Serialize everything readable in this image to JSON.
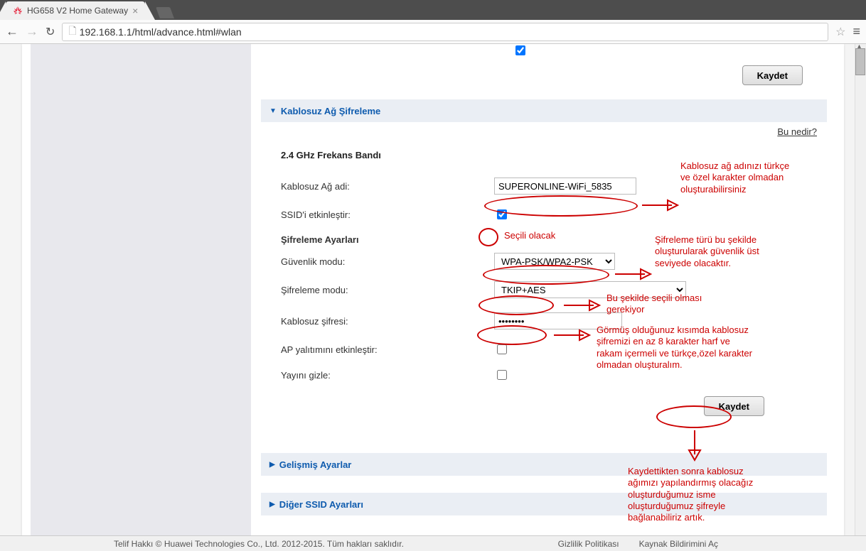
{
  "browser": {
    "tab_title": "HG658 V2 Home Gateway",
    "url": "192.168.1.1/html/advance.html#wlan"
  },
  "page": {
    "top_save_btn": "Kaydet",
    "section_wifi_enc": "Kablosuz Ağ Şifreleme",
    "help_link": "Bu nedir?",
    "band_title": "2.4 GHz Frekans Bandı",
    "rows": {
      "ssid_label": "Kablosuz Ağ adi:",
      "ssid_value": "SUPERONLINE-WiFi_5835",
      "ssid_enable_label": "SSID'i etkinleştir:",
      "enc_settings": "Şifreleme Ayarları",
      "sec_mode_label": "Güvenlik modu:",
      "sec_mode_value": "WPA-PSK/WPA2-PSK",
      "enc_mode_label": "Şifreleme modu:",
      "enc_mode_value": "TKIP+AES",
      "pwd_label": "Kablosuz şifresi:",
      "pwd_value": "••••••••",
      "ap_iso_label": "AP yalıtımını etkinleştir:",
      "hide_label": "Yayını gizle:"
    },
    "bottom_save_btn": "Kaydet",
    "section_advanced": "Gelişmiş Ayarlar",
    "section_other_ssid": "Diğer SSID Ayarları"
  },
  "annotations": {
    "ssid_note": "Kablosuz ağ adınızı türkçe ve özel karakter olmadan oluşturabilirsiniz",
    "ssid_enable_note": "Seçili olacak",
    "sec_note": "Şifreleme türü bu şekilde oluşturularak güvenlik üst seviyede olacaktır.",
    "enc_note": "Bu şekilde seçili olması gerekiyor",
    "pwd_note": "Görmüş olduğunuz kısımda kablosuz şifremizi en az 8 karakter harf ve rakam içermeli ve türkçe,özel karakter olmadan oluşturalım.",
    "save_note": "Kaydettikten sonra kablosuz ağımızı yapılandırmış olacağız oluşturduğumuz isme oluşturduğumuz şifreyle bağlanabiliriz artık."
  },
  "footer": {
    "copyright": "Telif Hakkı © Huawei Technologies Co., Ltd. 2012-2015. Tüm hakları saklıdır.",
    "privacy": "Gizlilik Politikası",
    "source": "Kaynak Bildirimini Aç"
  }
}
